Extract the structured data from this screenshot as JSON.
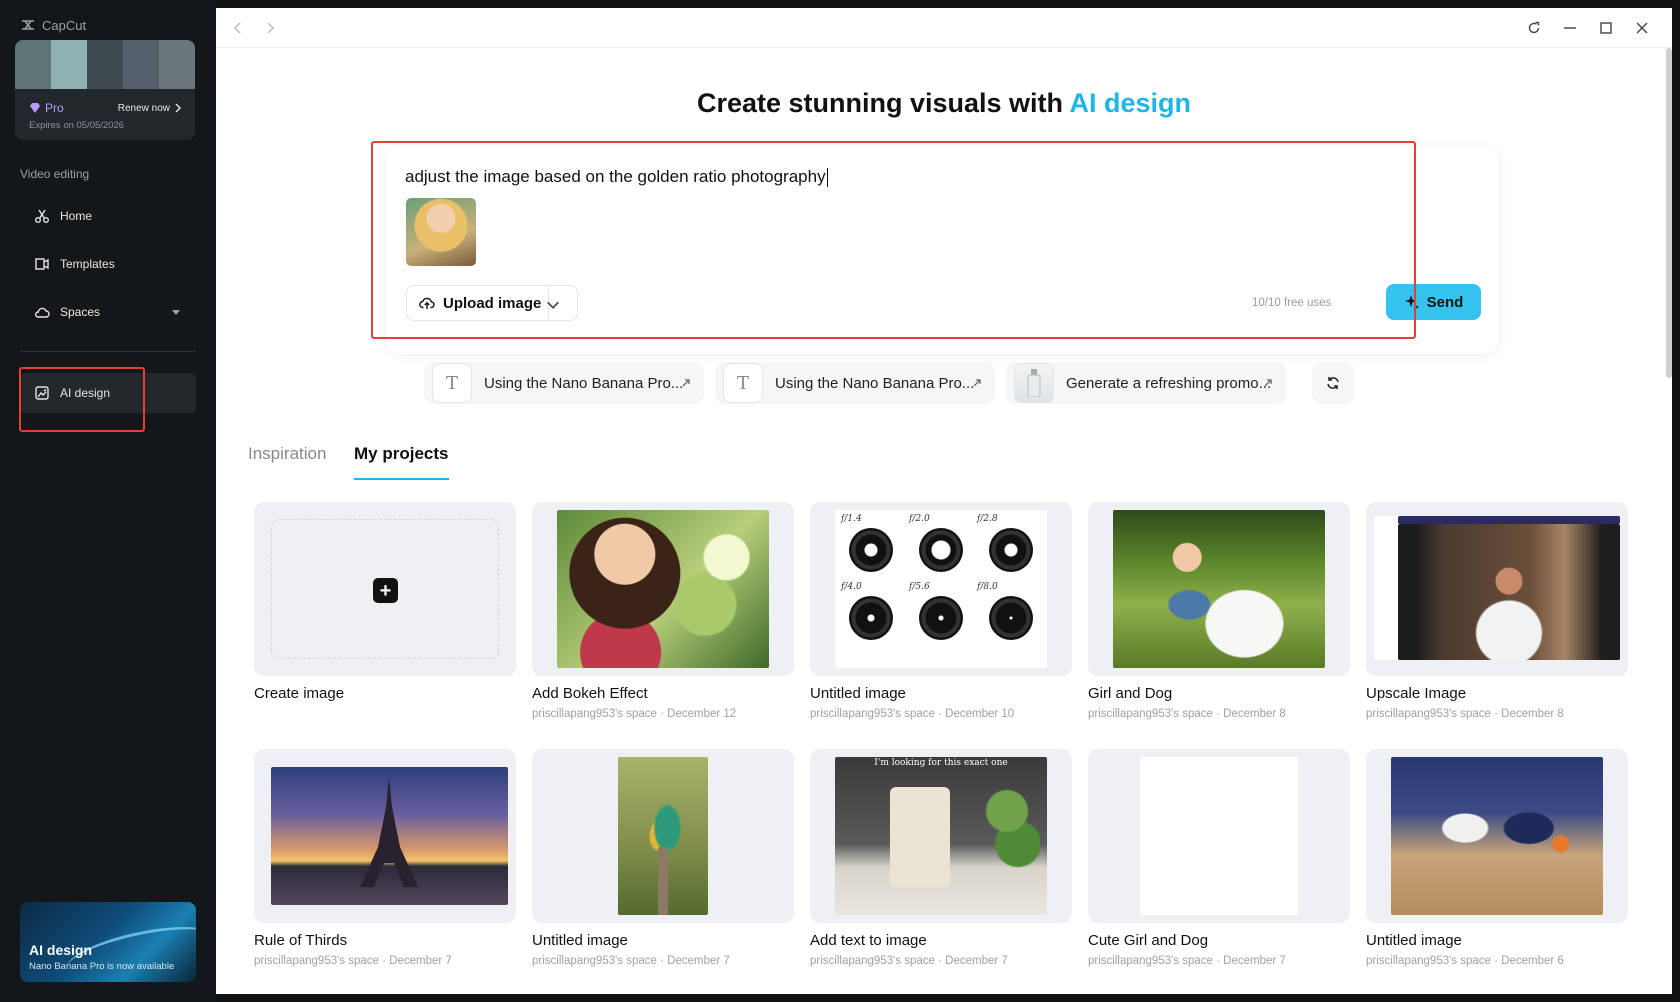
{
  "sidebar": {
    "logo_text": "CapCut",
    "account": {
      "plan": "Pro",
      "renew_label": "Renew now",
      "expires": "Expires on 05/05/2026"
    },
    "section_label": "Video editing",
    "nav": [
      {
        "label": "Home",
        "icon": "home-icon"
      },
      {
        "label": "Templates",
        "icon": "templates-icon"
      },
      {
        "label": "Spaces",
        "icon": "cloud-icon"
      },
      {
        "label": "AI design",
        "icon": "ai-design-icon"
      }
    ],
    "promo": {
      "title": "AI design",
      "subtitle": "Nano Banana Pro is now available"
    }
  },
  "hero": {
    "title_prefix": "Create stunning visuals with ",
    "title_accent": "AI design"
  },
  "prompt": {
    "text": "adjust the image based on the golden ratio photography",
    "upload_label": "Upload image",
    "free_uses": "10/10 free uses",
    "send_label": "Send"
  },
  "suggestions": [
    {
      "label": "Using the Nano Banana Pro..."
    },
    {
      "label": "Using the Nano Banana Pro..."
    },
    {
      "label": "Generate a refreshing promo..."
    }
  ],
  "tabs": [
    {
      "label": "Inspiration",
      "active": false
    },
    {
      "label": "My projects",
      "active": true
    }
  ],
  "projects": [
    {
      "title": "Create image",
      "subtitle": ""
    },
    {
      "title": "Add Bokeh Effect",
      "subtitle": "priscillapang953's space · December 12"
    },
    {
      "title": "Untitled image",
      "subtitle": "priscillapang953's space · December 10"
    },
    {
      "title": "Girl and Dog",
      "subtitle": "priscillapang953's space · December 8"
    },
    {
      "title": "Upscale Image",
      "subtitle": "priscillapang953's space · December 8"
    },
    {
      "title": "Rule of Thirds",
      "subtitle": "priscillapang953's space · December 7"
    },
    {
      "title": "Untitled image",
      "subtitle": "priscillapang953's space · December 7"
    },
    {
      "title": "Add text to image",
      "subtitle": "priscillapang953's space · December 7"
    },
    {
      "title": "Cute Girl and Dog",
      "subtitle": "priscillapang953's space · December 7"
    },
    {
      "title": "Untitled image",
      "subtitle": "priscillapang953's space · December 6"
    }
  ],
  "lens_labels": [
    "f/1.4",
    "f/2.0",
    "f/2.8",
    "f/4.0",
    "f/5.6",
    "f/8.0"
  ],
  "image_caption": "I'm looking for this exact one",
  "colors": {
    "accent": "#1eb6e6",
    "send_button": "#34c3ee",
    "highlight": "#e3403a",
    "pro": "#b59bff"
  }
}
